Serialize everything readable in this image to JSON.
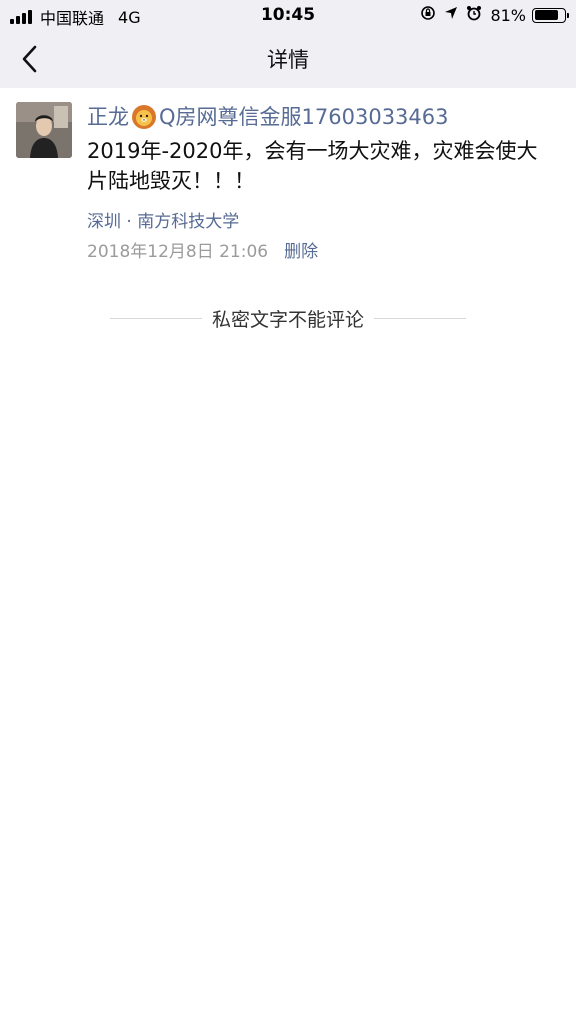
{
  "status_bar": {
    "carrier": "中国联通",
    "network": "4G",
    "time": "10:45",
    "battery": "81%",
    "battery_level": 0.81
  },
  "nav": {
    "title": "详情"
  },
  "post": {
    "author_prefix": "正龙",
    "author_suffix": "Q房网尊信金服17603033463",
    "text": "2019年-2020年，会有一场大灾难，灾难会使大片陆地毁灭！！！",
    "location": "深圳 · 南方科技大学",
    "timestamp": "2018年12月8日 21:06",
    "delete_label": "删除"
  },
  "private_note": "私密文字不能评论",
  "colors": {
    "link": "#576b95",
    "bar_bg": "#efeff4",
    "meta": "#9b9b9b"
  }
}
